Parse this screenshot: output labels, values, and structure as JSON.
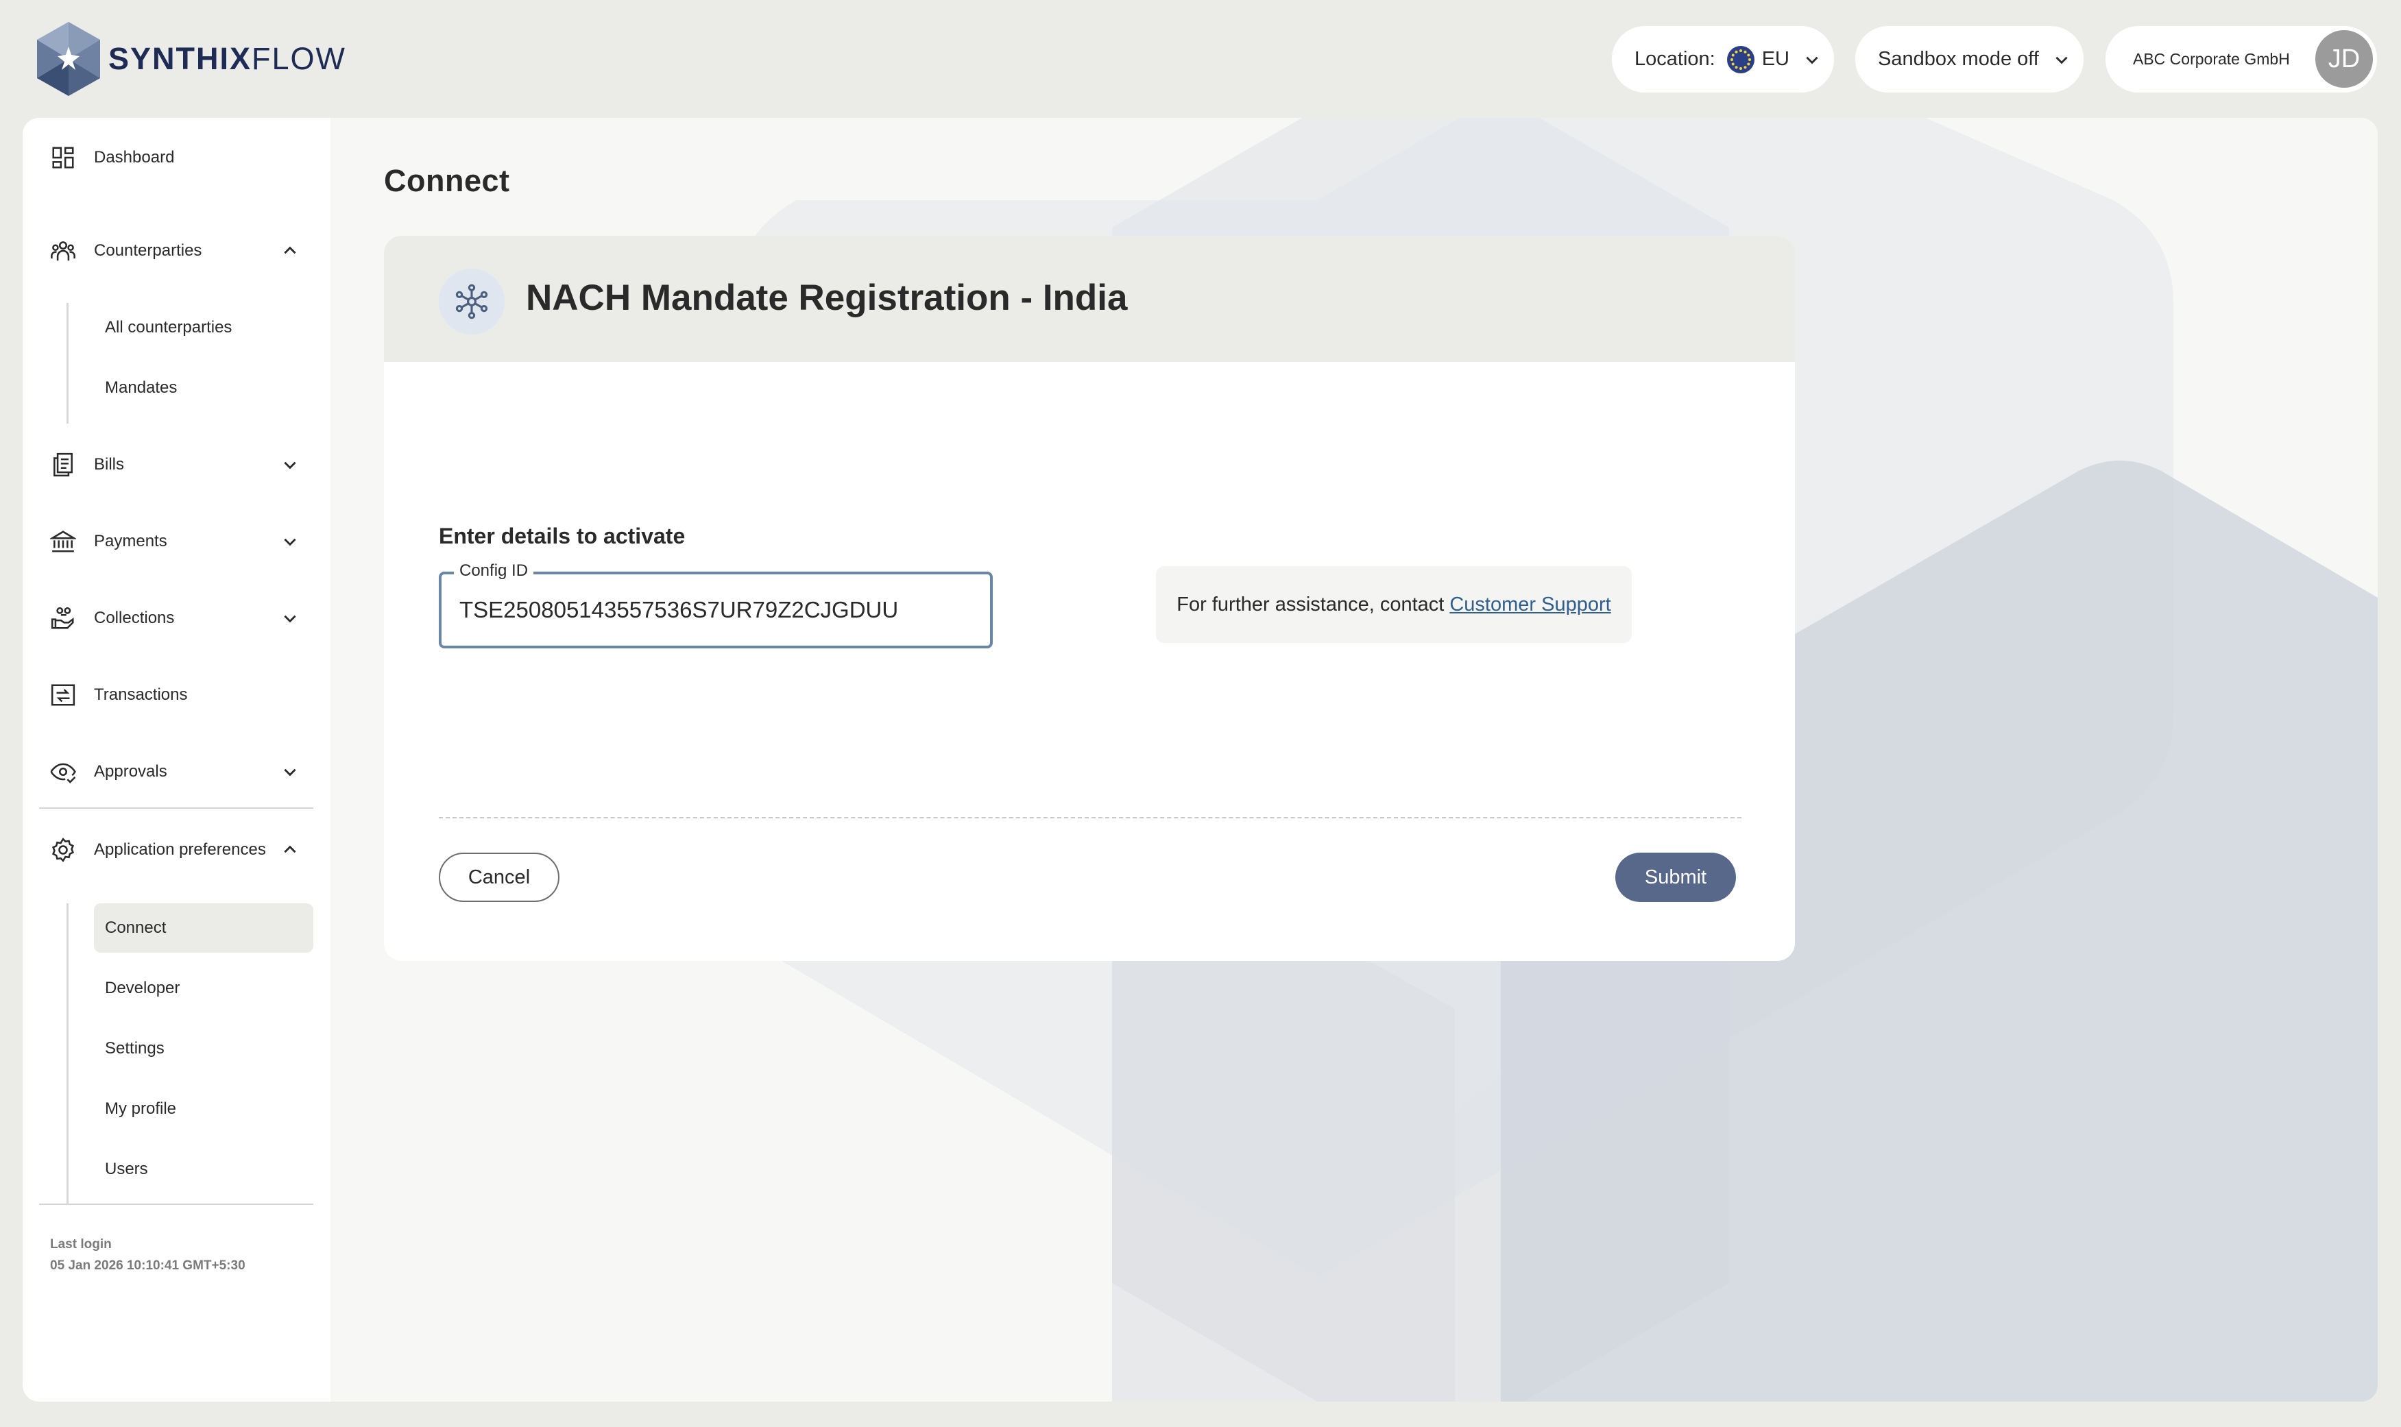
{
  "app": {
    "brand_bold": "SYNTHIX",
    "brand_light": "FLOW"
  },
  "header": {
    "location_label": "Location:",
    "location_value": "EU",
    "sandbox_label": "Sandbox mode off",
    "account_name": "ABC Corporate GmbH",
    "avatar_initials": "JD"
  },
  "sidebar": {
    "items": {
      "dashboard": {
        "label": "Dashboard",
        "icon": "dashboard-icon"
      },
      "counterparties": {
        "label": "Counterparties",
        "icon": "people-icon",
        "expanded": true
      },
      "bills": {
        "label": "Bills",
        "icon": "bills-icon"
      },
      "payments": {
        "label": "Payments",
        "icon": "bank-icon"
      },
      "collections": {
        "label": "Collections",
        "icon": "collections-icon"
      },
      "transactions": {
        "label": "Transactions",
        "icon": "transactions-icon"
      },
      "approvals": {
        "label": "Approvals",
        "icon": "eye-check-icon"
      },
      "preferences": {
        "label": "Application preferences",
        "icon": "gear-icon",
        "expanded": true
      }
    },
    "counterparties_sub": [
      "All counterparties",
      "Mandates"
    ],
    "preferences_sub": [
      "Connect",
      "Developer",
      "Settings",
      "My profile",
      "Users"
    ],
    "active_sub": "Connect",
    "last_login_label": "Last login",
    "last_login_value": "05 Jan 2026 10:10:41 GMT+5:30"
  },
  "main": {
    "page_title": "Connect",
    "card": {
      "title": "NACH Mandate Registration - India",
      "section_label": "Enter details to activate",
      "field_label": "Config ID",
      "field_value": "TSE250805143557536S7UR79Z2CJGDUU",
      "help_text": "For further assistance, contact",
      "help_link": "Customer Support",
      "cancel_label": "Cancel",
      "submit_label": "Submit"
    }
  },
  "colors": {
    "accent": "#58688a",
    "field_border": "#6a86a7",
    "link": "#2f5f8f",
    "brand_navy": "#1e2c55",
    "frame": "#ebebe7"
  }
}
